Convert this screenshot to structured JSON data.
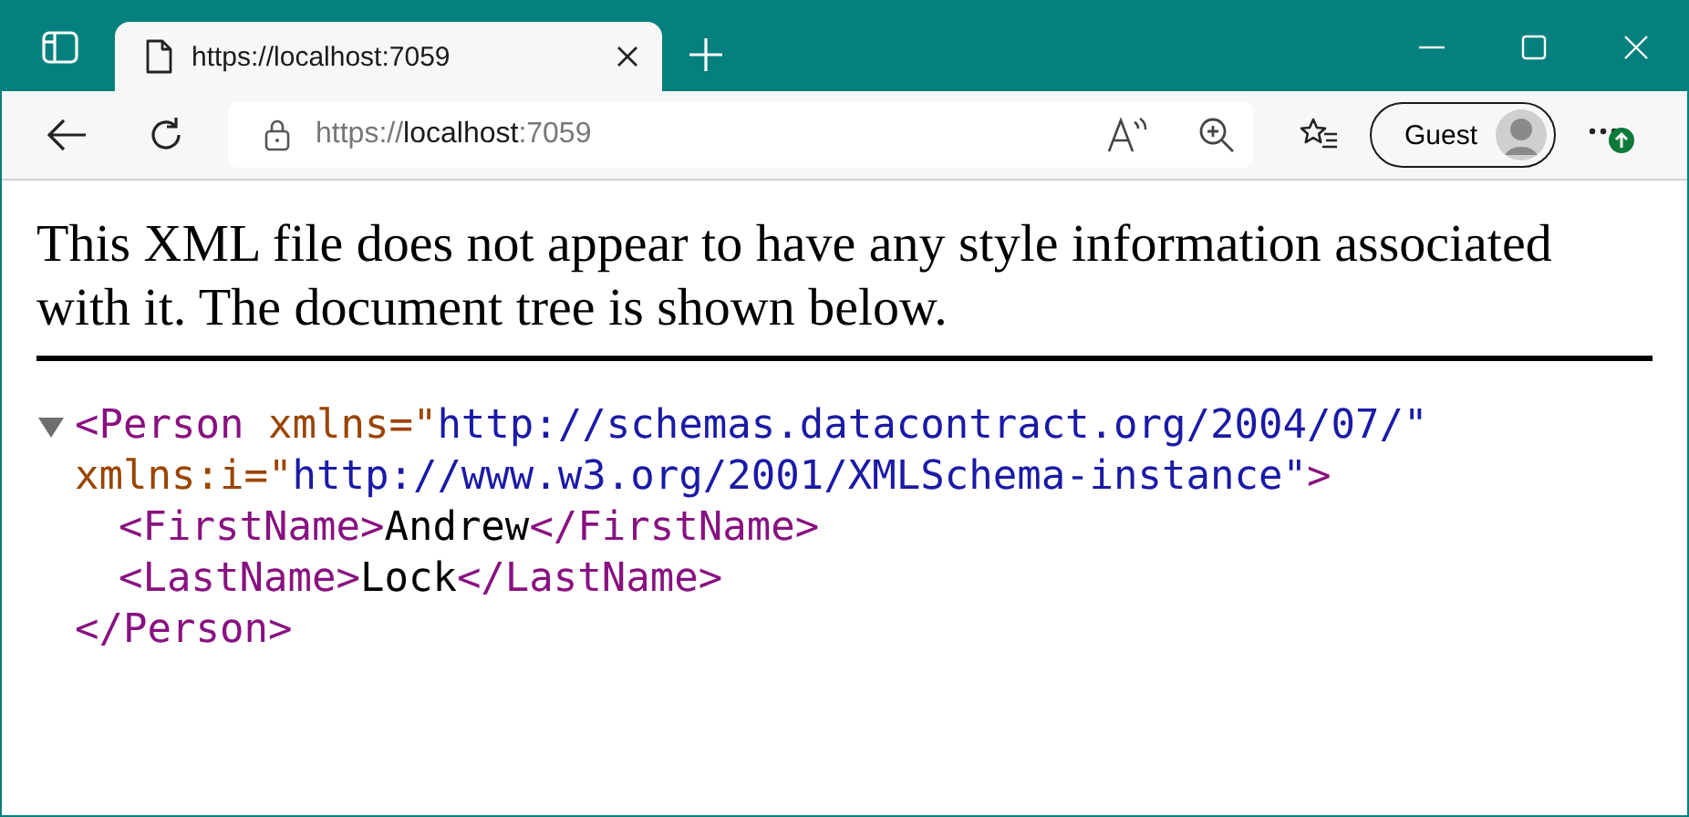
{
  "tabs": [
    {
      "title": "https://localhost:7059",
      "selected": true
    }
  ],
  "address_bar": {
    "url_prefix": "https://",
    "url_host": "localhost",
    "url_suffix": ":7059"
  },
  "profile": {
    "label": "Guest"
  },
  "notice": "This XML file does not appear to have any style information associated with it. The document tree is shown below.",
  "xml_tree": {
    "expanded": true,
    "open_lines": [
      [
        {
          "kind": "tag",
          "text": "<Person"
        },
        {
          "kind": "attr",
          "text": " xmlns=\""
        },
        {
          "kind": "value",
          "text": "http://schemas.datacontract.org/2004/07/\""
        }
      ],
      [
        {
          "kind": "attr",
          "text": "xmlns:i=\""
        },
        {
          "kind": "value",
          "text": "http://www.w3.org/2001/XMLSchema-instance\""
        },
        {
          "kind": "tag",
          "text": ">"
        }
      ]
    ],
    "children": [
      {
        "line": [
          {
            "kind": "tag",
            "text": "<FirstName>"
          },
          {
            "kind": "text",
            "text": "Andrew"
          },
          {
            "kind": "tag",
            "text": "</FirstName>"
          }
        ]
      },
      {
        "line": [
          {
            "kind": "tag",
            "text": "<LastName>"
          },
          {
            "kind": "text",
            "text": "Lock"
          },
          {
            "kind": "tag",
            "text": "</LastName>"
          }
        ]
      }
    ],
    "close_line": [
      {
        "kind": "tag",
        "text": "</Person>"
      }
    ]
  }
}
